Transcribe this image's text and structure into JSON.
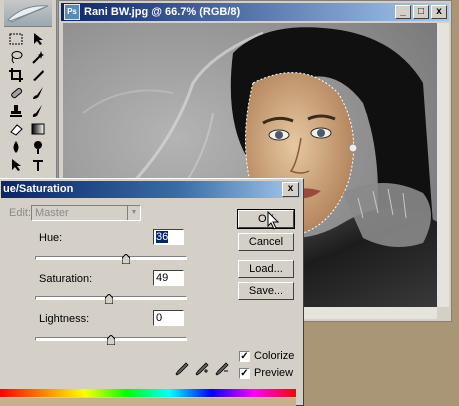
{
  "document": {
    "title": "Rani BW.jpg @ 66.7% (RGB/8)",
    "minimize_glyph": "_",
    "maximize_glyph": "□",
    "close_glyph": "x"
  },
  "dialog": {
    "title": "ue/Saturation",
    "close_glyph": "x",
    "edit_label": "Edit:",
    "edit_value": "Master",
    "hue_label": "Hue:",
    "hue_value": "36",
    "hue_level": 0.6,
    "saturation_label": "Saturation:",
    "saturation_value": "49",
    "saturation_level": 0.49,
    "lightness_label": "Lightness:",
    "lightness_value": "0",
    "lightness_level": 0.5,
    "buttons": {
      "ok": "OK",
      "cancel": "Cancel",
      "load": "Load...",
      "save": "Save..."
    },
    "colorize_label": "Colorize",
    "colorize_checked": true,
    "preview_label": "Preview",
    "preview_checked": true,
    "check_glyph": "✓"
  },
  "colors": {
    "titlebar": "#0a246a",
    "workspace": "#a89676",
    "skin_tint": "#c8a070"
  }
}
